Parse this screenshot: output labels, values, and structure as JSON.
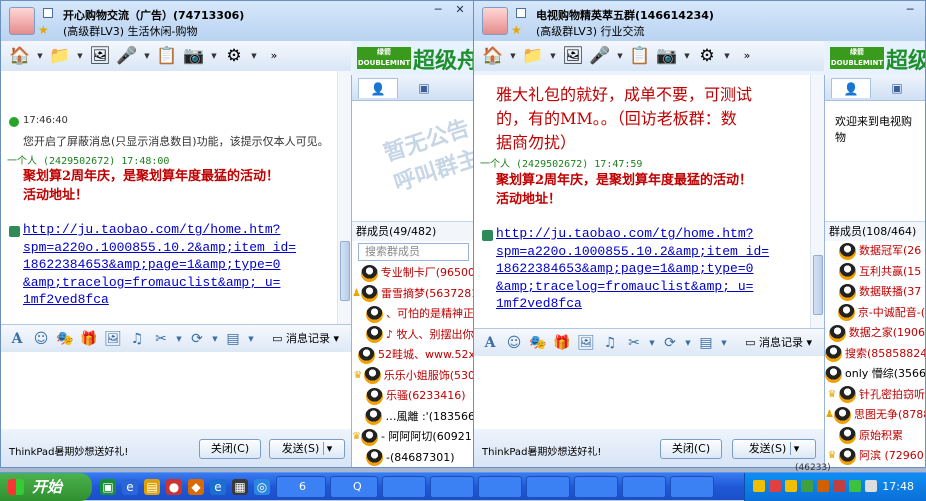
{
  "window1": {
    "title": "开心购物交流（广告）(74713306)",
    "subtitle": "(高级群LV3) 生活休闲-购物",
    "messages": {
      "sys_time": "17:46:40",
      "sys_text": "您开启了屏蔽消息(只显示消息数目)功能，该提示仅本人可见。",
      "sender": "一个人 (2429502672)  17:48:00",
      "line1": "聚划算2周年庆，是聚划算年度最猛的活动！",
      "line2": "活动地址！",
      "link": [
        "http://ju.taobao.com/tg/home.htm?",
        "spm=a220o.1000855.10.2&amp;item_id=",
        "18622384653&amp;page=1&amp;type=0",
        "&amp;tracelog=fromauclist&amp;_u=",
        "1mf2ved8fca"
      ]
    },
    "members_header": "群成员(49/482)",
    "search_placeholder": "搜索群成员",
    "members": [
      {
        "name": "专业制卡厂(96500",
        "badge": "",
        "color": "red"
      },
      {
        "name": "雷雪摘梦(5637281",
        "badge": "person",
        "color": "red"
      },
      {
        "name": "、可怕的是精神正",
        "badge": "",
        "color": "red"
      },
      {
        "name": "♪ 牧人、别摆出你",
        "badge": "",
        "color": "red"
      },
      {
        "name": "52畦城、www.52x",
        "badge": "",
        "color": "red"
      },
      {
        "name": "乐乐小姐服饰(530",
        "badge": "crown",
        "color": "red"
      },
      {
        "name": "乐骚(6233416)",
        "badge": "",
        "color": "red"
      },
      {
        "name": "…風離 :'(183566",
        "badge": "",
        "color": "black"
      },
      {
        "name": "- 阿阿阿切(609211",
        "badge": "crown",
        "color": "black"
      },
      {
        "name": "-(84687301)",
        "badge": "",
        "color": "black"
      }
    ],
    "history_label": "消息记录",
    "ad_text": "ThinkPad暑期妙想送好礼!",
    "close_btn": "关闭(C)",
    "send_btn": "发送(S)"
  },
  "window2": {
    "title": "电视购物精英萃五群(146614234)",
    "subtitle": "(高级群LV3) 行业交流",
    "messages": {
      "big1": "雅大礼包的就好，成单不要，可测试",
      "big2": "的，有的MM。。（回访老板群：数",
      "big3": "据商勿扰）",
      "sender": "一个人 (2429502672)  17:47:59",
      "line1": "聚划算2周年庆，是聚划算年度最猛的活动！",
      "line2": "活动地址！",
      "link": [
        "http://ju.taobao.com/tg/home.htm?",
        "spm=a220o.1000855.10.2&amp;item_id=",
        "18622384653&amp;page=1&amp;type=0",
        "&amp;tracelog=fromauclist&amp;_u=",
        "1mf2ved8fca"
      ]
    },
    "welcome": "欢迎来到电视购物",
    "members_header": "群成员(108/464)",
    "members": [
      {
        "name": "数据冠军(26",
        "badge": "",
        "color": "red"
      },
      {
        "name": "互利共赢(15",
        "badge": "",
        "color": "red"
      },
      {
        "name": "数据联播(37",
        "badge": "",
        "color": "red"
      },
      {
        "name": "京-中诚配音-(",
        "badge": "",
        "color": "red"
      },
      {
        "name": "数据之家(1906",
        "badge": "",
        "color": "red"
      },
      {
        "name": "搜索(85858824",
        "badge": "",
        "color": "red"
      },
      {
        "name": "only 懵综(3566",
        "badge": "",
        "color": "black"
      },
      {
        "name": "针孔密拍窃听",
        "badge": "crown",
        "color": "red"
      },
      {
        "name": "思图无争(8788",
        "badge": "person",
        "color": "red"
      },
      {
        "name": "原始积累",
        "badge": "",
        "color": "red"
      },
      {
        "name": "阿滨 (72960",
        "badge": "crown",
        "color": "red"
      }
    ],
    "history_label": "消息记录",
    "ad_text": "ThinkPad暑期妙想送好礼!",
    "close_btn": "关闭(C)",
    "send_btn": "发送(S)",
    "bottom_ghost": "(46233)"
  },
  "banner": {
    "brand": "DOUBLEMINT",
    "brand_sub": "绿箭",
    "headline": "超级舟"
  },
  "taskbar": {
    "start": "开始",
    "task1": "6",
    "task2": "Q",
    "clock": "17:48"
  }
}
